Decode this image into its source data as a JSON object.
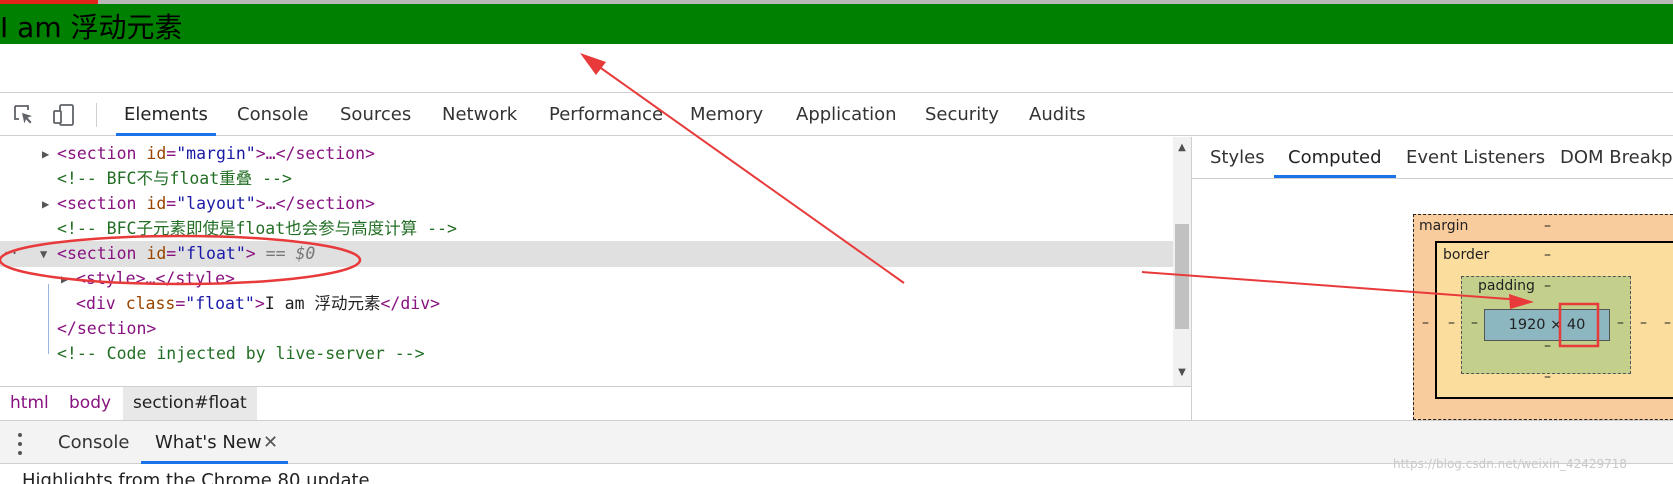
{
  "page": {
    "float_text": "I am 浮动元素",
    "float_bg": "#008000"
  },
  "devtools": {
    "tabs": [
      "Elements",
      "Console",
      "Sources",
      "Network",
      "Performance",
      "Memory",
      "Application",
      "Security",
      "Audits"
    ],
    "active_tab": "Elements",
    "icons": [
      "select-element-icon",
      "device-toolbar-icon"
    ]
  },
  "elements": {
    "lines": [
      {
        "open": "<",
        "tag": "section",
        "attr": "id",
        "val": "\"margin\"",
        "rest": ">…</",
        "close_tag": "section",
        "end": ">"
      },
      {
        "comment": "<!-- BFC不与float重叠 -->"
      },
      {
        "open": "<",
        "tag": "section",
        "attr": "id",
        "val": "\"layout\"",
        "rest": ">…</",
        "close_tag": "section",
        "end": ">"
      },
      {
        "comment": "<!-- BFC子元素即使是float也会参与高度计算 -->"
      },
      {
        "open": "<",
        "tag": "section",
        "attr": "id",
        "val": "\"float\"",
        "end": ">",
        "selected_marker": "== $0"
      },
      {
        "open": "<",
        "tag": "style",
        "rest": ">…</",
        "close_tag": "style",
        "end": ">"
      },
      {
        "open": "<",
        "tag": "div",
        "attr": "class",
        "val": "\"float\"",
        "end": ">",
        "text": "I am 浮动元素",
        "close_open": "</",
        "close_tag": "div",
        "close_end": ">"
      },
      {
        "open": "</",
        "tag": "section",
        "end": ">"
      },
      {
        "comment": "<!-- Code injected by live-server -->"
      }
    ],
    "ellipsis": "…"
  },
  "breadcrumbs": [
    "html",
    "body",
    "section#float"
  ],
  "sidebar": {
    "tabs": [
      "Styles",
      "Computed",
      "Event Listeners",
      "DOM Breakpoints"
    ],
    "active_tab": "Computed",
    "box_model": {
      "margin_label": "margin",
      "border_label": "border",
      "padding_label": "padding",
      "dash": "–",
      "content_size": "1920 × 40"
    }
  },
  "drawer": {
    "tabs": [
      "Console",
      "What's New"
    ],
    "active_tab": "What's New",
    "close_glyph": "✕",
    "highlights": "Highlights from the Chrome 80 update"
  },
  "watermark": "https://blog.csdn.net/weixin_42429718",
  "colors": {
    "annotation_red": "#e83a3a",
    "active_tab_underline": "#1a73e8",
    "margin_box": "#f9cc9d",
    "border_box": "#fbdd9d",
    "padding_box": "#c3d08b",
    "content_box": "#8cb6c0"
  }
}
